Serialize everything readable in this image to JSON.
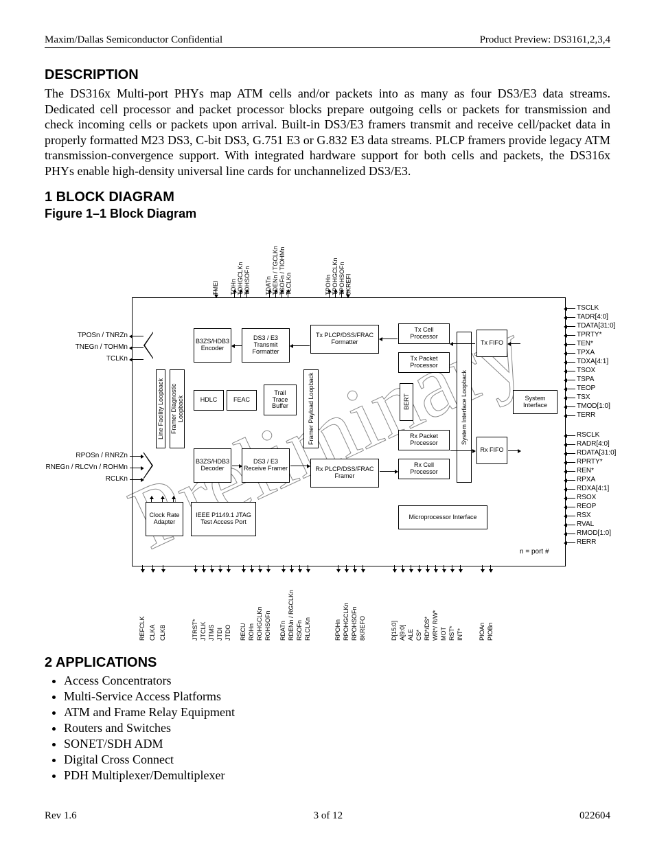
{
  "header": {
    "left": "Maxim/Dallas Semiconductor Confidential",
    "right": "Product Preview: DS3161,2,3,4"
  },
  "description": {
    "heading": "DESCRIPTION",
    "text": "The DS316x Multi-port PHYs map ATM cells and/or packets into as many as four DS3/E3 data streams. Dedicated cell processor and packet processor blocks prepare outgoing cells or packets for transmission and check incoming cells or packets upon arrival.  Built-in DS3/E3 framers transmit and receive cell/packet data in properly formatted M23 DS3, C-bit DS3, G.751 E3 or G.832 E3 data streams.  PLCP framers provide legacy ATM transmission-convergence support.  With integrated hardware support for both cells and packets, the DS316x PHYs enable high-density universal line cards for unchannelized DS3/E3."
  },
  "section1": {
    "heading": "1   BLOCK DIAGRAM",
    "figcap": "Figure 1–1  Block Diagram"
  },
  "section2": {
    "heading": "2   APPLICATIONS",
    "items": [
      "Access Concentrators",
      "Multi-Service Access Platforms",
      "ATM and Frame Relay Equipment",
      "Routers and Switches",
      "SONET/SDH ADM",
      "Digital Cross Connect",
      "PDH Multiplexer/Demultiplexer"
    ]
  },
  "footer": {
    "left": "Rev 1.6",
    "center": "3 of 12",
    "right": "022604"
  },
  "chart_data": {
    "type": "diagram",
    "title": "Figure 1–1 Block Diagram",
    "note": "n = port #",
    "blocks": [
      "B3ZS/HDB3 Encoder",
      "DS3 / E3 Transmit Formatter",
      "Tx PLCP/DSS/FRAC Formatter",
      "Tx Cell Processor",
      "Tx Packet Processor",
      "Tx FIFO",
      "HDLC",
      "FEAC",
      "Trail Trace Buffer",
      "BERT",
      "System Interface",
      "B3ZS/HDB3 Decoder",
      "DS3 / E3 Receive Framer",
      "Rx PLCP/DSS/FRAC Framer",
      "Rx Packet Processor",
      "Rx Cell Processor",
      "Rx FIFO",
      "Clock Rate Adapter",
      "IEEE P1149.1 JTAG Test Access Port",
      "Microprocessor Interface"
    ],
    "loopbacks": [
      "Line Facility Loopback",
      "Framer Diagnostic Loopback",
      "Framer Payload Loopback",
      "System Interface Loopback"
    ],
    "pins_left_tx": [
      "TPOSn / TNRZn",
      "TNEGn / TOHMn",
      "TCLKn"
    ],
    "pins_left_rx": [
      "RPOSn / RNRZn",
      "RNEGn / RLCVn / ROHMn",
      "RCLKn"
    ],
    "pins_top": [
      "TMEI",
      "TOHn\nTOHGCLKn\nTOHSOFn",
      "TDATn\nTDENn / TGCLKn\nTSOFn / TIOHMn\nTLCLKn",
      "TPOHn\nTPOHGCLKn\nTPOHSOFn\n8KREFI"
    ],
    "pins_right_tx": [
      "TSCLK",
      "TADR[4:0]",
      "TDATA[31:0]",
      "TPRTY*",
      "TEN*",
      "TPXA",
      "TDXA[4:1]",
      "TSOX",
      "TSPA",
      "TEOP",
      "TSX",
      "TMOD[1:0]",
      "TERR"
    ],
    "pins_right_rx": [
      "RSCLK",
      "RADR[4:0]",
      "RDATA[31:0]",
      "RPRTY*",
      "REN*",
      "RPXA",
      "RDXA[4:1]",
      "RSOX",
      "REOP",
      "RSX",
      "RVAL",
      "RMOD[1:0]",
      "RERR"
    ],
    "pins_bottom": [
      "REFCLK",
      "CLKA",
      "CLKB",
      "JTRST*",
      "JTCLK",
      "JTMS",
      "JTDI",
      "JTDO",
      "RECU",
      "ROHn",
      "ROHGCLKn",
      "ROHSOFn",
      "RDATn",
      "RDENn / RGCLKn",
      "RSOFn",
      "RLCLKn",
      "RPOHn",
      "RPOHGCLKn",
      "RPOHSOFn",
      "8KREFO",
      "D[15:0]",
      "A[9:0]",
      "ALE",
      "CS*",
      "RD*/DS*",
      "WR*/ R/W*",
      "MOT",
      "RST*",
      "INT*",
      "PIOAn",
      "PIOBn"
    ]
  }
}
